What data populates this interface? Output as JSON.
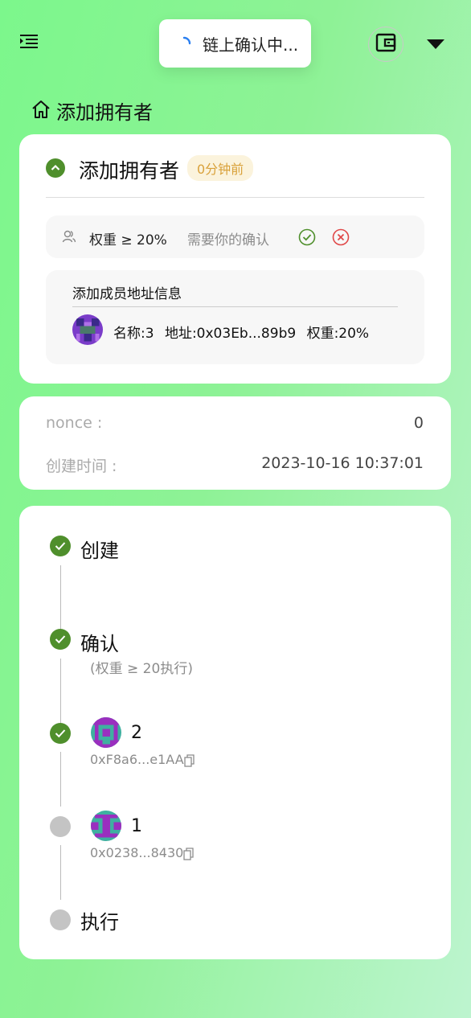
{
  "toast": {
    "text": "链上确认中..."
  },
  "breadcrumb": {
    "label": "添加拥有者"
  },
  "proposal": {
    "title": "添加拥有者",
    "time_badge": "0分钟前",
    "threshold_label": "权重 ≥ 20%",
    "need_confirm": "需要你的确认",
    "info_title": "添加成员地址信息",
    "member": {
      "name": "名称:3",
      "address": "地址:0x03Eb...89b9",
      "weight": "权重:20%"
    }
  },
  "meta": {
    "nonce_label": "nonce :",
    "nonce_value": "0",
    "created_label": "创建时间 :",
    "created_value": "2023-10-16 10:37:01"
  },
  "timeline": {
    "create": "创建",
    "confirm": "确认",
    "confirm_sub": "(权重 ≥ 20执行)",
    "signer1": {
      "name": "2",
      "address": "0xF8a6...e1AA",
      "status": "confirmed"
    },
    "signer2": {
      "name": "1",
      "address": "0x0238...8430",
      "status": "pending"
    },
    "execute": "执行"
  },
  "colors": {
    "accent_green": "#4f8f2c",
    "badge_text": "#d9a13a",
    "reject_red": "#e04848"
  }
}
